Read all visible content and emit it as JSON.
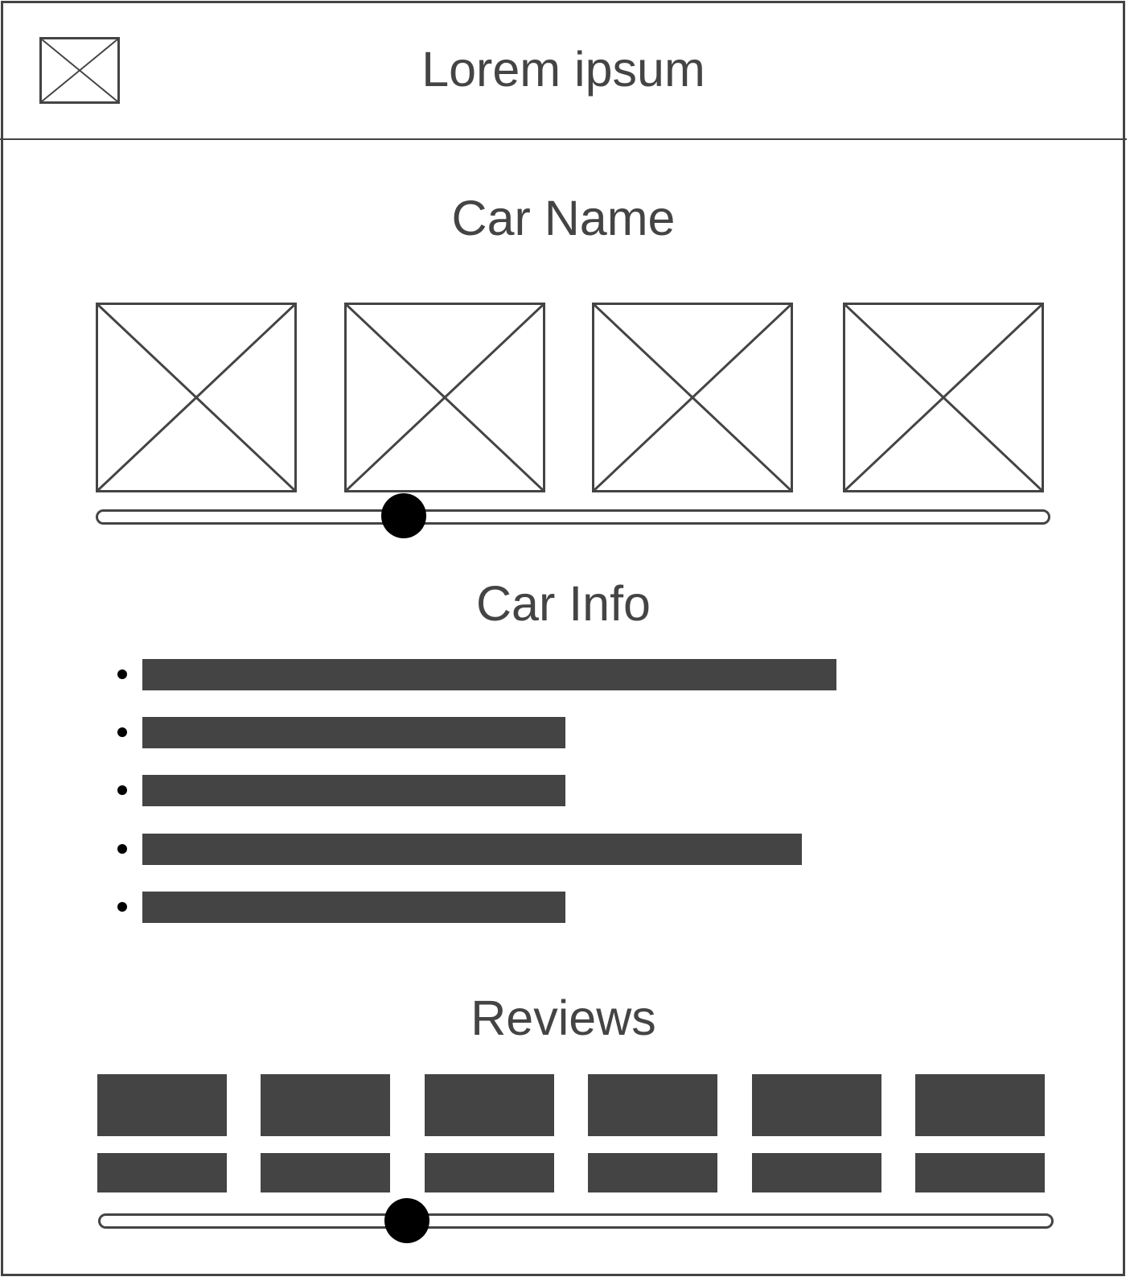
{
  "header": {
    "title": "Lorem ipsum",
    "logo_icon": "image-placeholder-icon"
  },
  "gallery": {
    "title": "Car Name",
    "images": [
      "image-placeholder",
      "image-placeholder",
      "image-placeholder",
      "image-placeholder"
    ],
    "slider_value_percent": 32
  },
  "info": {
    "title": "Car Info",
    "items": [
      {
        "fill_percent": 100
      },
      {
        "fill_percent": 61
      },
      {
        "fill_percent": 61
      },
      {
        "fill_percent": 95
      },
      {
        "fill_percent": 61
      }
    ]
  },
  "reviews": {
    "title": "Reviews",
    "count": 6,
    "slider_value_percent": 32
  },
  "colors": {
    "stroke": "#444444",
    "knob": "#000000"
  }
}
